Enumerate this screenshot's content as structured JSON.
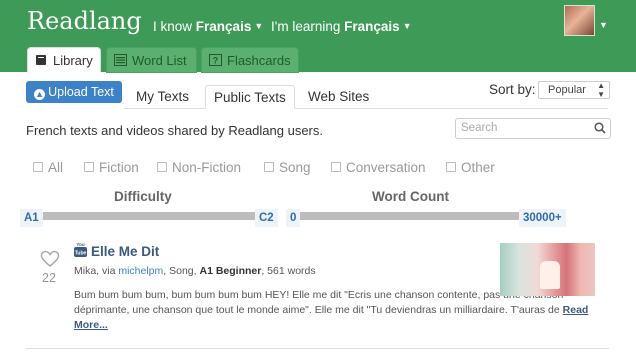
{
  "header": {
    "brand": "Readlang",
    "i_know_prefix": "I know",
    "i_know_lang": "Français",
    "learning_prefix": "I'm learning",
    "learning_lang": "Français"
  },
  "main_tabs": [
    {
      "label": "Library",
      "icon": "book-icon",
      "active": true
    },
    {
      "label": "Word List",
      "icon": "list-icon",
      "active": false
    },
    {
      "label": "Flashcards",
      "icon": "question-card-icon",
      "active": false
    }
  ],
  "toolbar": {
    "upload_label": "Upload Text",
    "subtabs": [
      "My Texts",
      "Public Texts",
      "Web Sites"
    ],
    "active_subtab": "Public Texts",
    "sort_label": "Sort by:",
    "sort_value": "Popular"
  },
  "description": "French texts and videos shared by Readlang users.",
  "search": {
    "placeholder": "Search"
  },
  "filters": [
    "All",
    "Fiction",
    "Non-Fiction",
    "Song",
    "Conversation",
    "Other"
  ],
  "difficulty": {
    "title": "Difficulty",
    "min": "A1",
    "max": "C2"
  },
  "word_count": {
    "title": "Word Count",
    "min": "0",
    "max": "30000+"
  },
  "items": [
    {
      "title": "Elle Me Dit",
      "likes": "22",
      "meta_artist": "Mika, via ",
      "meta_user": "michelpm",
      "meta_genre": ", Song, ",
      "meta_level": "A1 Beginner",
      "meta_words": ", 561 words",
      "excerpt": "Bum bum bum bum, bum bum bum bum HEY! Elle me dit \"Ecris une chanson contente, pas une chanson déprimante, une chanson que tout le monde aime\". Elle me dit \"Tu deviendras un milliardaire. T'auras de ",
      "more_label": "Read More..."
    }
  ],
  "colors": {
    "brand_green": "#3d9b57",
    "link_blue": "#3b82c8"
  }
}
